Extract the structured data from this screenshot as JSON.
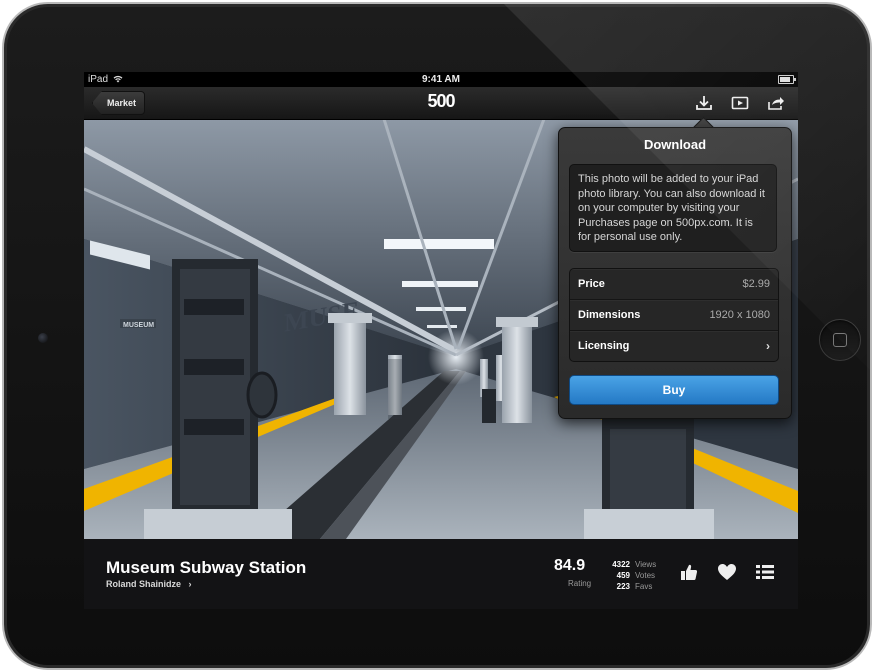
{
  "status_bar": {
    "device": "iPad",
    "time": "9:41 AM"
  },
  "navbar": {
    "back_label": "Market",
    "logo": "500"
  },
  "navbar_icons": [
    "download-icon",
    "slideshow-icon",
    "share-icon"
  ],
  "photo": {
    "title": "Museum Subway Station",
    "author": "Roland Shainidze",
    "rating": "84.9",
    "rating_label": "Rating",
    "stats": [
      {
        "value": "4322",
        "label": "Views"
      },
      {
        "value": "459",
        "label": "Votes"
      },
      {
        "value": "223",
        "label": "Favs"
      }
    ],
    "station_sign": "MUSEUM",
    "wall_text": "MUSE"
  },
  "actions": [
    "like-icon",
    "favorite-icon",
    "list-icon"
  ],
  "download_popover": {
    "title": "Download",
    "description": "This photo will be added to your iPad photo library. You can also download it on your computer by visiting your Purchases page on 500px.com. It is for personal use only.",
    "rows": [
      {
        "label": "Price",
        "value": "$2.99"
      },
      {
        "label": "Dimensions",
        "value": "1920 x 1080"
      },
      {
        "label": "Licensing",
        "value": ""
      }
    ],
    "buy_label": "Buy"
  },
  "colors": {
    "buy_blue": "#2a86d3",
    "safety_yellow": "#f0b400"
  }
}
